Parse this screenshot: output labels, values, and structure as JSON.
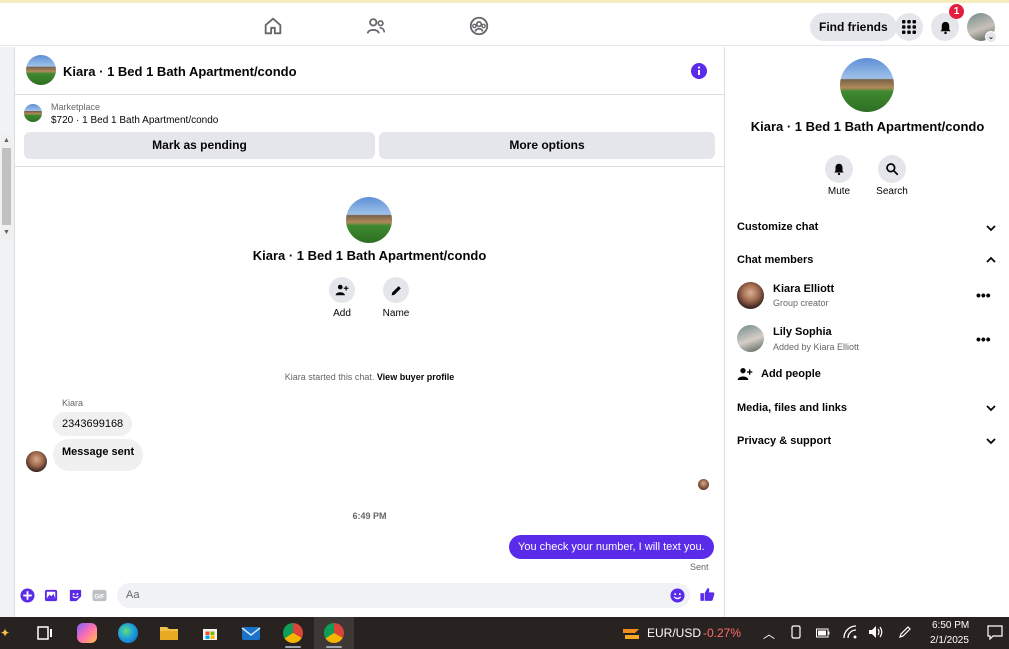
{
  "topbar": {
    "find_friends": "Find friends",
    "notification_count": "1"
  },
  "conversation": {
    "title": "Kiara · 1 Bed 1 Bath Apartment/condo"
  },
  "listing": {
    "label": "Marketplace",
    "price_title": "$720 · 1 Bed 1 Bath Apartment/condo",
    "mark_pending": "Mark as pending",
    "more_options": "More options"
  },
  "intro": {
    "title": "Kiara · 1 Bed 1 Bath Apartment/condo",
    "add_label": "Add",
    "name_label": "Name",
    "system_message": "Kiara started this chat.",
    "view_profile": "View buyer profile"
  },
  "messages": {
    "sender": "Kiara",
    "incoming": [
      "2343699168",
      "Message sent"
    ],
    "timestamp": "6:49 PM",
    "outgoing": "You check your number, I will text you.",
    "status": "Sent"
  },
  "composer": {
    "placeholder": "Aa",
    "gif_label": "GIF"
  },
  "sidebar": {
    "title": "Kiara · 1 Bed 1 Bath Apartment/condo",
    "mute": "Mute",
    "search": "Search",
    "customize_chat": "Customize chat",
    "chat_members": "Chat members",
    "members": [
      {
        "name": "Kiara Elliott",
        "role": "Group creator"
      },
      {
        "name": "Lily Sophia",
        "role": "Added by Kiara Elliott"
      }
    ],
    "add_people": "Add people",
    "media": "Media, files and links",
    "privacy": "Privacy & support"
  },
  "taskbar": {
    "ticker_pair": "EUR/USD",
    "ticker_change": "-0.27%",
    "time": "6:50 PM",
    "date": "2/1/2025"
  },
  "colors": {
    "accent": "#5b2bea",
    "badge": "#e41e3f",
    "taskbar": "#282321"
  }
}
